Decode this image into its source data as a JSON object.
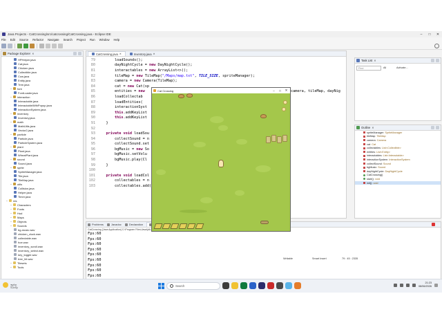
{
  "window": {
    "title": "Java Projects - CatCrossing/src/catcrossing/CatCrossing.java - Eclipse IDE"
  },
  "menu": [
    "File",
    "Edit",
    "Source",
    "Refactor",
    "Navigate",
    "Search",
    "Project",
    "Run",
    "Window",
    "Help"
  ],
  "package_explorer": {
    "title": "Package Explorer",
    "items": [
      {
        "label": "HPHelper.java",
        "level": 3,
        "kind": "java"
      },
      {
        "label": "Cat.java",
        "level": 3,
        "kind": "java"
      },
      {
        "label": "Chicken.java",
        "level": 3,
        "kind": "java"
      },
      {
        "label": "Collectible.java",
        "level": 3,
        "kind": "java"
      },
      {
        "label": "Cow.java",
        "level": 3,
        "kind": "java"
      },
      {
        "label": "Entity.java",
        "level": 3,
        "kind": "java"
      },
      {
        "label": "Tree.java",
        "level": 3,
        "kind": "java"
      },
      {
        "label": "font",
        "level": 2,
        "kind": "pkg"
      },
      {
        "label": "FontLoader.java",
        "level": 3,
        "kind": "java"
      },
      {
        "label": "interaction",
        "level": 2,
        "kind": "pkg"
      },
      {
        "label": "Interactable.java",
        "level": 3,
        "kind": "java"
      },
      {
        "label": "InteractableWithPopup.java",
        "level": 3,
        "kind": "java"
      },
      {
        "label": "InteractionSystem.java",
        "level": 3,
        "kind": "java"
      },
      {
        "label": "inventory",
        "level": 2,
        "kind": "pkg"
      },
      {
        "label": "Inventory.java",
        "level": 3,
        "kind": "java"
      },
      {
        "label": "math",
        "level": 2,
        "kind": "pkg"
      },
      {
        "label": "MathUtils.java",
        "level": 3,
        "kind": "java"
      },
      {
        "label": "Vector2.java",
        "level": 3,
        "kind": "java"
      },
      {
        "label": "particle",
        "level": 2,
        "kind": "pkg"
      },
      {
        "label": "Particle.java",
        "level": 3,
        "kind": "java"
      },
      {
        "label": "ParticleSystem.java",
        "level": 3,
        "kind": "java"
      },
      {
        "label": "plant",
        "level": 2,
        "kind": "pkg"
      },
      {
        "label": "Plant.java",
        "level": 3,
        "kind": "java"
      },
      {
        "label": "WheatPlant.java",
        "level": 3,
        "kind": "java"
      },
      {
        "label": "sound",
        "level": 2,
        "kind": "pkg"
      },
      {
        "label": "Sound.java",
        "level": 3,
        "kind": "java"
      },
      {
        "label": "sprite",
        "level": 2,
        "kind": "pkg"
      },
      {
        "label": "SpriteManager.java",
        "level": 3,
        "kind": "java"
      },
      {
        "label": "Tile.java",
        "level": 3,
        "kind": "java"
      },
      {
        "label": "TileMap.java",
        "level": 3,
        "kind": "java"
      },
      {
        "label": "utils",
        "level": 2,
        "kind": "pkg"
      },
      {
        "label": "Collision.java",
        "level": 3,
        "kind": "java"
      },
      {
        "label": "Helper.java",
        "level": 3,
        "kind": "java"
      },
      {
        "label": "Timer.java",
        "level": 3,
        "kind": "java"
      },
      {
        "label": "res",
        "level": 1,
        "kind": "folder"
      },
      {
        "label": "Characters",
        "level": 2,
        "kind": "folder"
      },
      {
        "label": "Fonts",
        "level": 2,
        "kind": "folder"
      },
      {
        "label": "Hud",
        "level": 2,
        "kind": "folder"
      },
      {
        "label": "Maps",
        "level": 2,
        "kind": "folder"
      },
      {
        "label": "Objects",
        "level": 2,
        "kind": "folder"
      },
      {
        "label": "Sounds",
        "level": 2,
        "kind": "folder"
      },
      {
        "label": "bg-music.wav",
        "level": 3,
        "kind": "wav"
      },
      {
        "label": "chicken_cluck.wav",
        "level": 3,
        "kind": "wav"
      },
      {
        "label": "collectable.wav",
        "level": 3,
        "kind": "wav"
      },
      {
        "label": "hoe.wav",
        "level": 3,
        "kind": "wav"
      },
      {
        "label": "inventory_scroll.wav",
        "level": 3,
        "kind": "wav"
      },
      {
        "label": "inventory_select.wav",
        "level": 3,
        "kind": "wav"
      },
      {
        "label": "key_toggle.wav",
        "level": 3,
        "kind": "wav"
      },
      {
        "label": "tree_hit.wav",
        "level": 3,
        "kind": "wav"
      },
      {
        "label": "Tilesets",
        "level": 2,
        "kind": "folder"
      },
      {
        "label": "Tools",
        "level": 2,
        "kind": "folder"
      }
    ]
  },
  "editor": {
    "tabs": [
      {
        "label": "CatCrossing.java",
        "active": true
      },
      {
        "label": "Inventory.java",
        "active": false
      }
    ],
    "lines": [
      {
        "n": "79",
        "html": "        loadSounds();"
      },
      {
        "n": "80",
        "html": "        dayNightCycle = <span class=\"kw\">new</span> DayNightCycle();"
      },
      {
        "n": "81",
        "html": "        interactables = <span class=\"kw\">new</span> ArrayList&lt;&gt;();"
      },
      {
        "n": "82",
        "html": "        tileMap = <span class=\"kw\">new</span> TileMap(<span class=\"str\">\"/Maps/map.txt\"</span>, <span class=\"cst\">TILE_SIZE</span>, spriteManager);"
      },
      {
        "n": "83",
        "html": "        camera = <span class=\"kw\">new</span> Camera(TileMap);"
      },
      {
        "n": "84",
        "html": "        cat = <span class=\"kw\">new</span> Cat(sp"
      },
      {
        "n": "85",
        "html": "        entities = <span class=\"kw\">new</span>"
      },
      {
        "n": "86",
        "html": "        loadCollectab"
      },
      {
        "n": "87",
        "html": "        loadEntities("
      },
      {
        "n": "88",
        "html": "        interactionSyst"
      },
      {
        "n": "89",
        "html": "        <span class=\"kw\">this</span>.addKeyList"
      },
      {
        "n": "90",
        "html": "        <span class=\"kw\">this</span>.addKeyList"
      },
      {
        "n": "91",
        "html": "    }"
      },
      {
        "n": "92",
        "html": ""
      },
      {
        "n": "93",
        "html": "    <span class=\"kw\">private void</span> loadSou"
      },
      {
        "n": "94",
        "html": "        collectSound = n"
      },
      {
        "n": "95",
        "html": "        collectSound.set"
      },
      {
        "n": "96",
        "html": "        bgMusic = <span class=\"kw\">new</span> So"
      },
      {
        "n": "97",
        "html": "        bgMusic.setVolu"
      },
      {
        "n": "98",
        "html": "        bgMusic.play(Cl"
      },
      {
        "n": "99",
        "html": "    }"
      },
      {
        "n": "100",
        "html": ""
      },
      {
        "n": "101",
        "html": "    <span class=\"kw\">private void</span> loadCol"
      },
      {
        "n": "102",
        "html": "        collectables = n"
      },
      {
        "n": "103",
        "html": "        collectables.add("
      }
    ],
    "fragment": "camera, tileMap, dayNig"
  },
  "task_list": {
    "title": "Task List",
    "search_placeholder": "Find",
    "all_label": "All",
    "activate_label": "Activate..."
  },
  "outline": {
    "title": "Outline",
    "items": [
      {
        "name": "spriteManager",
        "type": ": SpriteManager",
        "vis": "private",
        "sel": false
      },
      {
        "name": "tileMap",
        "type": ": TileMap",
        "vis": "private",
        "sel": false
      },
      {
        "name": "camera",
        "type": ": Camera",
        "vis": "private",
        "sel": false
      },
      {
        "name": "cat",
        "type": ": Cat",
        "vis": "private",
        "sel": false
      },
      {
        "name": "collectables",
        "type": ": List<Collectible>",
        "vis": "private",
        "sel": false
      },
      {
        "name": "entities",
        "type": ": List<Entity>",
        "vis": "private",
        "sel": false
      },
      {
        "name": "interactables",
        "type": ": List<Interactable>",
        "vis": "private",
        "sel": false
      },
      {
        "name": "interactionSystem",
        "type": ": InteractionSystem",
        "vis": "private",
        "sel": false
      },
      {
        "name": "collectSound",
        "type": ": Sound",
        "vis": "private",
        "sel": false
      },
      {
        "name": "bgMusic",
        "type": ": Sound",
        "vis": "private",
        "sel": false
      },
      {
        "name": "dayNightCycle",
        "type": ": DayNightCycle",
        "vis": "private",
        "sel": false
      },
      {
        "name": "CatCrossing()",
        "type": "",
        "vis": "public",
        "sel": false
      },
      {
        "name": "start()",
        "type": ": void",
        "vis": "public",
        "sel": false
      },
      {
        "name": "init()",
        "type": ": void",
        "vis": "private",
        "sel": true
      }
    ]
  },
  "console": {
    "tabs": [
      "Problems",
      "Javadoc",
      "Declaration",
      "Console"
    ],
    "desc": "CatCrossing [Java Application] C:\\Program Files\\Java\\jdk-...\\bin\\javaw.exe",
    "lines": [
      "Fps:60",
      "Fps:60",
      "Fps:60",
      "Fps:60",
      "Fps:60",
      "Fps:60",
      "Fps:60",
      "Fps:60",
      "Fps:60",
      "Fps:60"
    ]
  },
  "game": {
    "title": "Cat Crossing"
  },
  "taskbar": {
    "temp": "72°C",
    "weather_desc": "Sunny",
    "search_placeholder": "Search",
    "time": "21:23",
    "date": "08/06/2026"
  },
  "status": {
    "writable": "Writable",
    "insert": "Smart Insert",
    "position": "79 : 45 : 2335"
  },
  "colors": {
    "game_grass": "#a4c74b",
    "keyword": "#7f0055",
    "string": "#2a00ff"
  }
}
